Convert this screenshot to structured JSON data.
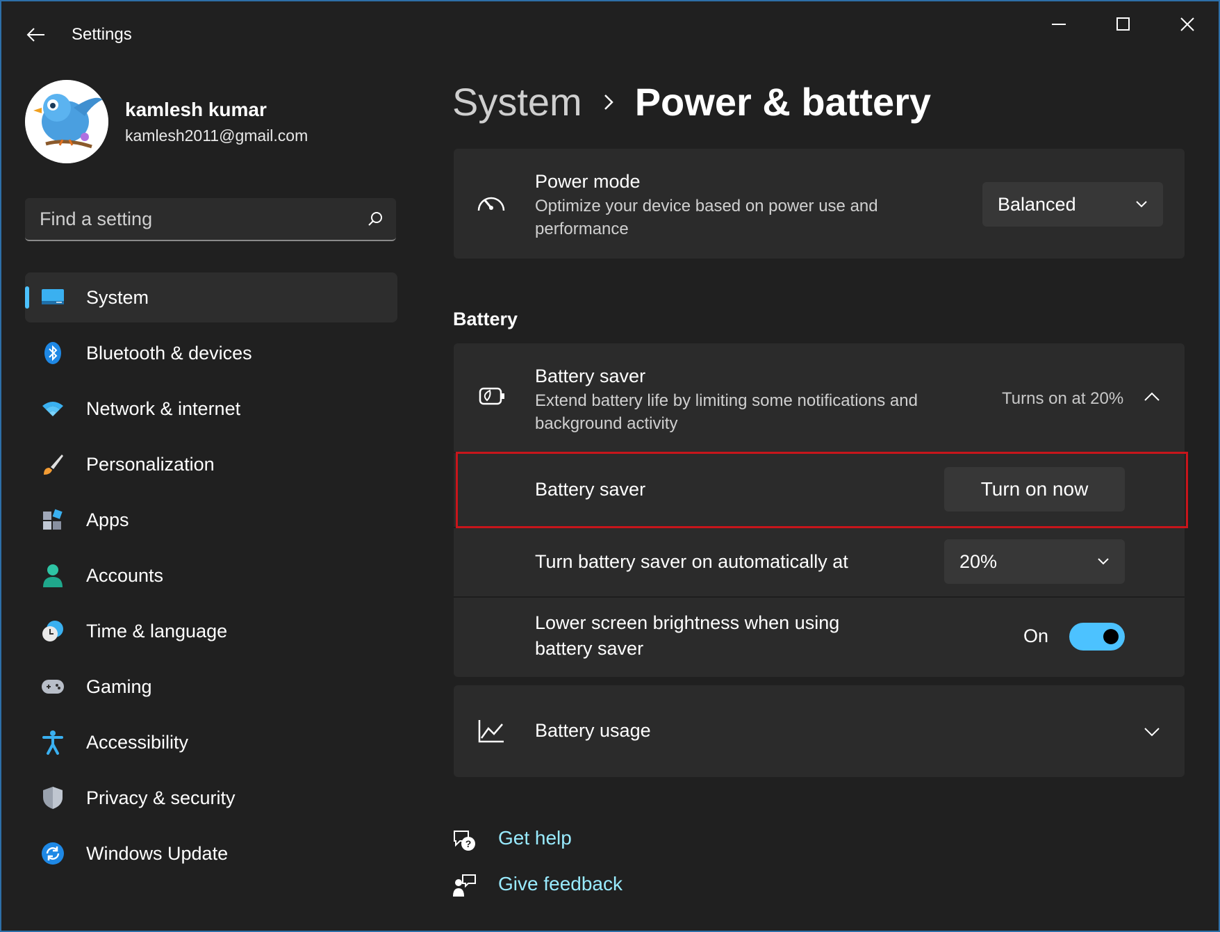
{
  "window": {
    "title": "Settings"
  },
  "user": {
    "name": "kamlesh kumar",
    "email": "kamlesh2011@gmail.com"
  },
  "search": {
    "placeholder": "Find a setting"
  },
  "nav": {
    "items": [
      {
        "label": "System",
        "icon": "monitor-icon",
        "selected": true
      },
      {
        "label": "Bluetooth & devices",
        "icon": "bluetooth-icon"
      },
      {
        "label": "Network & internet",
        "icon": "wifi-icon"
      },
      {
        "label": "Personalization",
        "icon": "paintbrush-icon"
      },
      {
        "label": "Apps",
        "icon": "apps-icon"
      },
      {
        "label": "Accounts",
        "icon": "person-icon"
      },
      {
        "label": "Time & language",
        "icon": "clock-globe-icon"
      },
      {
        "label": "Gaming",
        "icon": "gamepad-icon"
      },
      {
        "label": "Accessibility",
        "icon": "accessibility-icon"
      },
      {
        "label": "Privacy & security",
        "icon": "shield-icon"
      },
      {
        "label": "Windows Update",
        "icon": "update-icon"
      }
    ]
  },
  "breadcrumb": {
    "parent": "System",
    "current": "Power & battery"
  },
  "power_mode": {
    "title": "Power mode",
    "description": "Optimize your device based on power use and performance",
    "value": "Balanced"
  },
  "battery_section": {
    "label": "Battery"
  },
  "battery_saver": {
    "title": "Battery saver",
    "description": "Extend battery life by limiting some notifications and background activity",
    "status": "Turns on at 20%",
    "row_label": "Battery saver",
    "button": "Turn on now",
    "auto_label": "Turn battery saver on automatically at",
    "auto_value": "20%",
    "brightness_label": "Lower screen brightness when using battery saver",
    "brightness_state": "On",
    "brightness_on": true
  },
  "battery_usage": {
    "title": "Battery usage"
  },
  "links": {
    "help": "Get help",
    "feedback": "Give feedback"
  },
  "colors": {
    "accent": "#4cc2ff",
    "link": "#99ebff",
    "highlight_border": "#c8151b",
    "card_bg": "#2b2b2b",
    "window_bg": "#202020"
  }
}
